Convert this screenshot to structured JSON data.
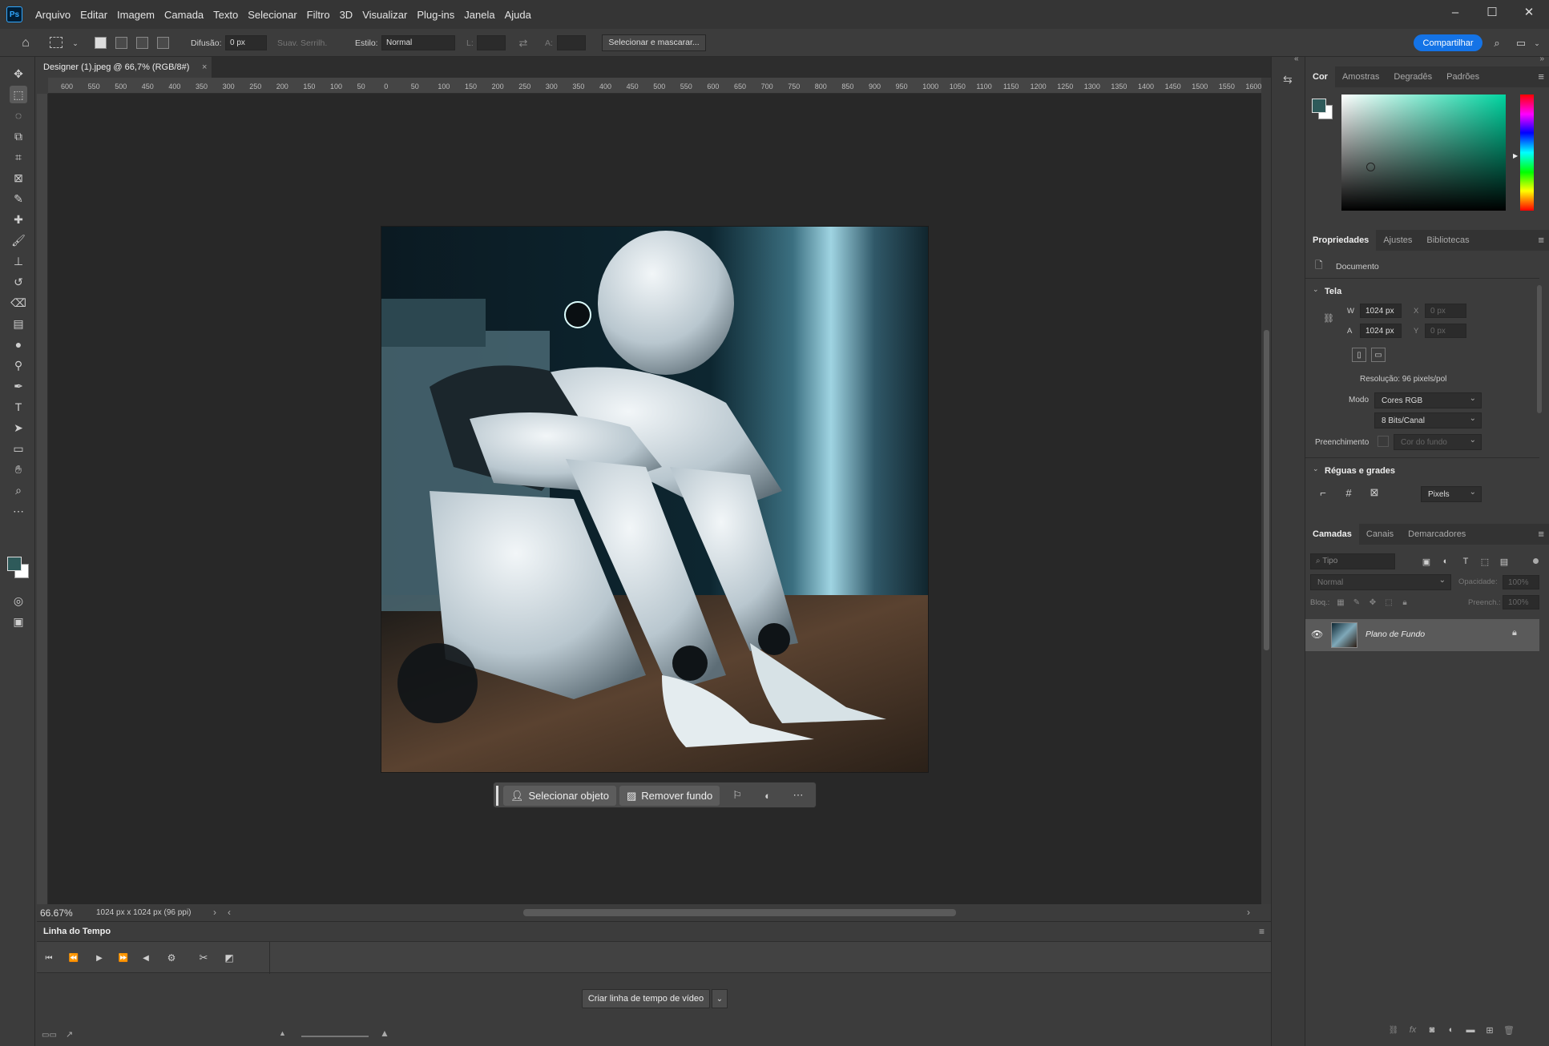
{
  "menubar": {
    "logo": "Ps",
    "items": [
      "Arquivo",
      "Editar",
      "Imagem",
      "Camada",
      "Texto",
      "Selecionar",
      "Filtro",
      "3D",
      "Visualizar",
      "Plug-ins",
      "Janela",
      "Ajuda"
    ],
    "window_controls": {
      "minimize": "–",
      "maximize": "☐",
      "close": "✕"
    }
  },
  "options": {
    "feather_label": "Difusão:",
    "feather_value": "0 px",
    "antialias_label": "Suav. Serrilh.",
    "style_label": "Estilo:",
    "style_value": "Normal",
    "width_label": "L:",
    "height_label": "A:",
    "select_mask_label": "Selecionar e mascarar...",
    "share_label": "Compartilhar"
  },
  "toolbar": {
    "icons": [
      "move-icon",
      "marquee-icon",
      "lasso-icon",
      "object-select-icon",
      "crop-icon",
      "frame-icon",
      "eyedropper-icon",
      "healing-icon",
      "brush-icon",
      "stamp-icon",
      "history-brush-icon",
      "eraser-icon",
      "gradient-icon",
      "blur-icon",
      "dodge-icon",
      "pen-icon",
      "type-icon",
      "path-select-icon",
      "rectangle-icon",
      "hand-icon",
      "zoom-icon",
      "more-icon"
    ],
    "foreground_color": "#2e5a5a",
    "background_color": "#ffffff"
  },
  "document": {
    "tab_title": "Designer (1).jpeg @ 66,7% (RGB/8#)",
    "ruler_ticks": [
      "600",
      "550",
      "500",
      "450",
      "400",
      "350",
      "300",
      "250",
      "200",
      "150",
      "100",
      "50",
      "0",
      "50",
      "100",
      "150",
      "200",
      "250",
      "300",
      "350",
      "400",
      "450",
      "500",
      "550",
      "600",
      "650",
      "700",
      "750",
      "800",
      "850",
      "900",
      "950",
      "1000",
      "1050",
      "1100",
      "1150",
      "1200",
      "1250",
      "1300",
      "1350",
      "1400",
      "1450",
      "1500",
      "1550",
      "1600"
    ]
  },
  "contextual_bar": {
    "select_object": "Selecionar objeto",
    "remove_background": "Remover fundo"
  },
  "status": {
    "zoom": "66.67%",
    "doc_info": "1024 px x 1024 px (96 ppi)"
  },
  "timeline": {
    "title": "Linha do Tempo",
    "create_button": "Criar linha de tempo de vídeo"
  },
  "color_panel": {
    "tabs": [
      "Cor",
      "Amostras",
      "Degradês",
      "Padrões"
    ],
    "hue_color": "#00d4a0"
  },
  "properties_panel": {
    "tabs": [
      "Propriedades",
      "Ajustes",
      "Bibliotecas"
    ],
    "doc_label": "Documento",
    "canvas_section": "Tela",
    "w_label": "W",
    "w_value": "1024 px",
    "h_label": "A",
    "h_value": "1024 px",
    "x_label": "X",
    "x_value": "0 px",
    "y_label": "Y",
    "y_value": "0 px",
    "resolution": "Resolução: 96 pixels/pol",
    "mode_label": "Modo",
    "mode_value": "Cores RGB",
    "bits_value": "8 Bits/Canal",
    "fill_label": "Preenchimento",
    "fill_value": "Cor do fundo",
    "rulers_section": "Réguas e grades",
    "units_value": "Pixels"
  },
  "layers_panel": {
    "tabs": [
      "Camadas",
      "Canais",
      "Demarcadores"
    ],
    "search_placeholder": "Tipo",
    "blend_mode": "Normal",
    "opacity_label": "Opacidade:",
    "opacity_value": "100%",
    "lock_label": "Bloq.:",
    "fill_label": "Preench.:",
    "fill_value": "100%",
    "layers": [
      {
        "name": "Plano de Fundo"
      }
    ]
  }
}
